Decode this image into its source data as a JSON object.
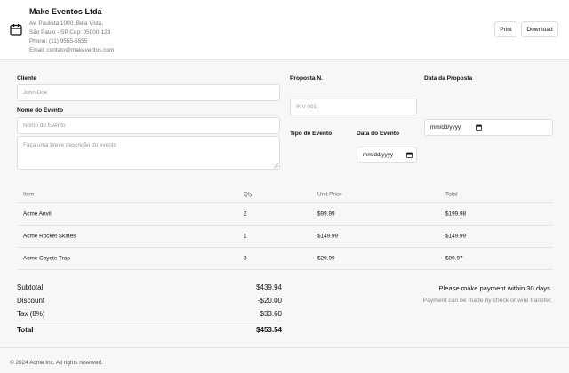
{
  "header": {
    "company_name": "Make Eventos Ltda",
    "address_line1": "Av. Paulista 1000, Bela Vista,",
    "address_line2": "São Paulo - SP Cep: 05000-123",
    "phone": "Phone: (11) 9555-5555",
    "email": "Email: contato@makeventos.com",
    "print_label": "Print",
    "download_label": "Download",
    "icon": "calendar-icon"
  },
  "form": {
    "cliente_label": "Cliente",
    "cliente_placeholder": "John Doe",
    "nome_evento_label": "Nome do Evento",
    "nome_evento_placeholder": "Nome do Evento",
    "descricao_placeholder": "Faça uma breve descrição do evento",
    "proposta_label": "Proposta N.",
    "proposta_placeholder": "INV-001",
    "data_proposta_label": "Data da Proposta",
    "data_proposta_value": "mm/dd/yyyy",
    "tipo_evento_label": "Tipo de Evento",
    "data_evento_label": "Data do Evento",
    "data_evento_value": "mm/dd/yyyy"
  },
  "table": {
    "headers": [
      "Item",
      "Qty",
      "Unit Price",
      "Total"
    ],
    "rows": [
      [
        "Acme Anvil",
        "2",
        "$99.99",
        "$199.98"
      ],
      [
        "Acme Rocket Skates",
        "1",
        "$149.99",
        "$149.99"
      ],
      [
        "Acme Coyote Trap",
        "3",
        "$29.99",
        "$89.97"
      ]
    ]
  },
  "summary": {
    "subtotal_label": "Subtotal",
    "subtotal_value": "$439.94",
    "discount_label": "Discount",
    "discount_value": "-$20.00",
    "tax_label": "Tax (8%)",
    "tax_value": "$33.60",
    "total_label": "Total",
    "total_value": "$453.54"
  },
  "notes": {
    "payment_terms": "Please make payment within 30 days.",
    "payment_method": "Payment can be made by check or wire transfer."
  },
  "footer": {
    "copyright": "© 2024 Acme Inc. All rights reserved."
  }
}
